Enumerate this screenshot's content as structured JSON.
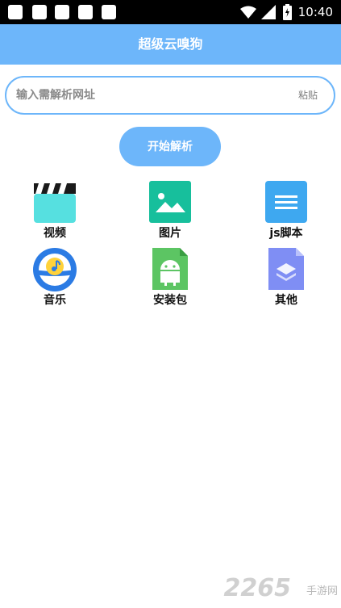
{
  "status_bar": {
    "time": "10:40",
    "icons": [
      "notification-square-icon",
      "notification-square-icon",
      "notification-square-icon",
      "notification-square-icon",
      "notification-square-icon",
      "wifi-icon",
      "cell-signal-icon",
      "battery-charging-icon"
    ]
  },
  "app_bar": {
    "title": "超级云嗅狗",
    "color": "#6db6fa"
  },
  "search": {
    "placeholder": "输入需解析网址",
    "value": "",
    "paste_label": "粘贴"
  },
  "parse_button": {
    "label": "开始解析"
  },
  "categories": [
    {
      "label": "视频",
      "icon": "video-clapper-icon"
    },
    {
      "label": "图片",
      "icon": "image-icon"
    },
    {
      "label": "js脚本",
      "icon": "document-lines-icon"
    },
    {
      "label": "音乐",
      "icon": "music-note-icon"
    },
    {
      "label": "安装包",
      "icon": "android-file-icon"
    },
    {
      "label": "其他",
      "icon": "layers-file-icon"
    }
  ],
  "watermark": {
    "number": "2265",
    "text": "手游网"
  }
}
